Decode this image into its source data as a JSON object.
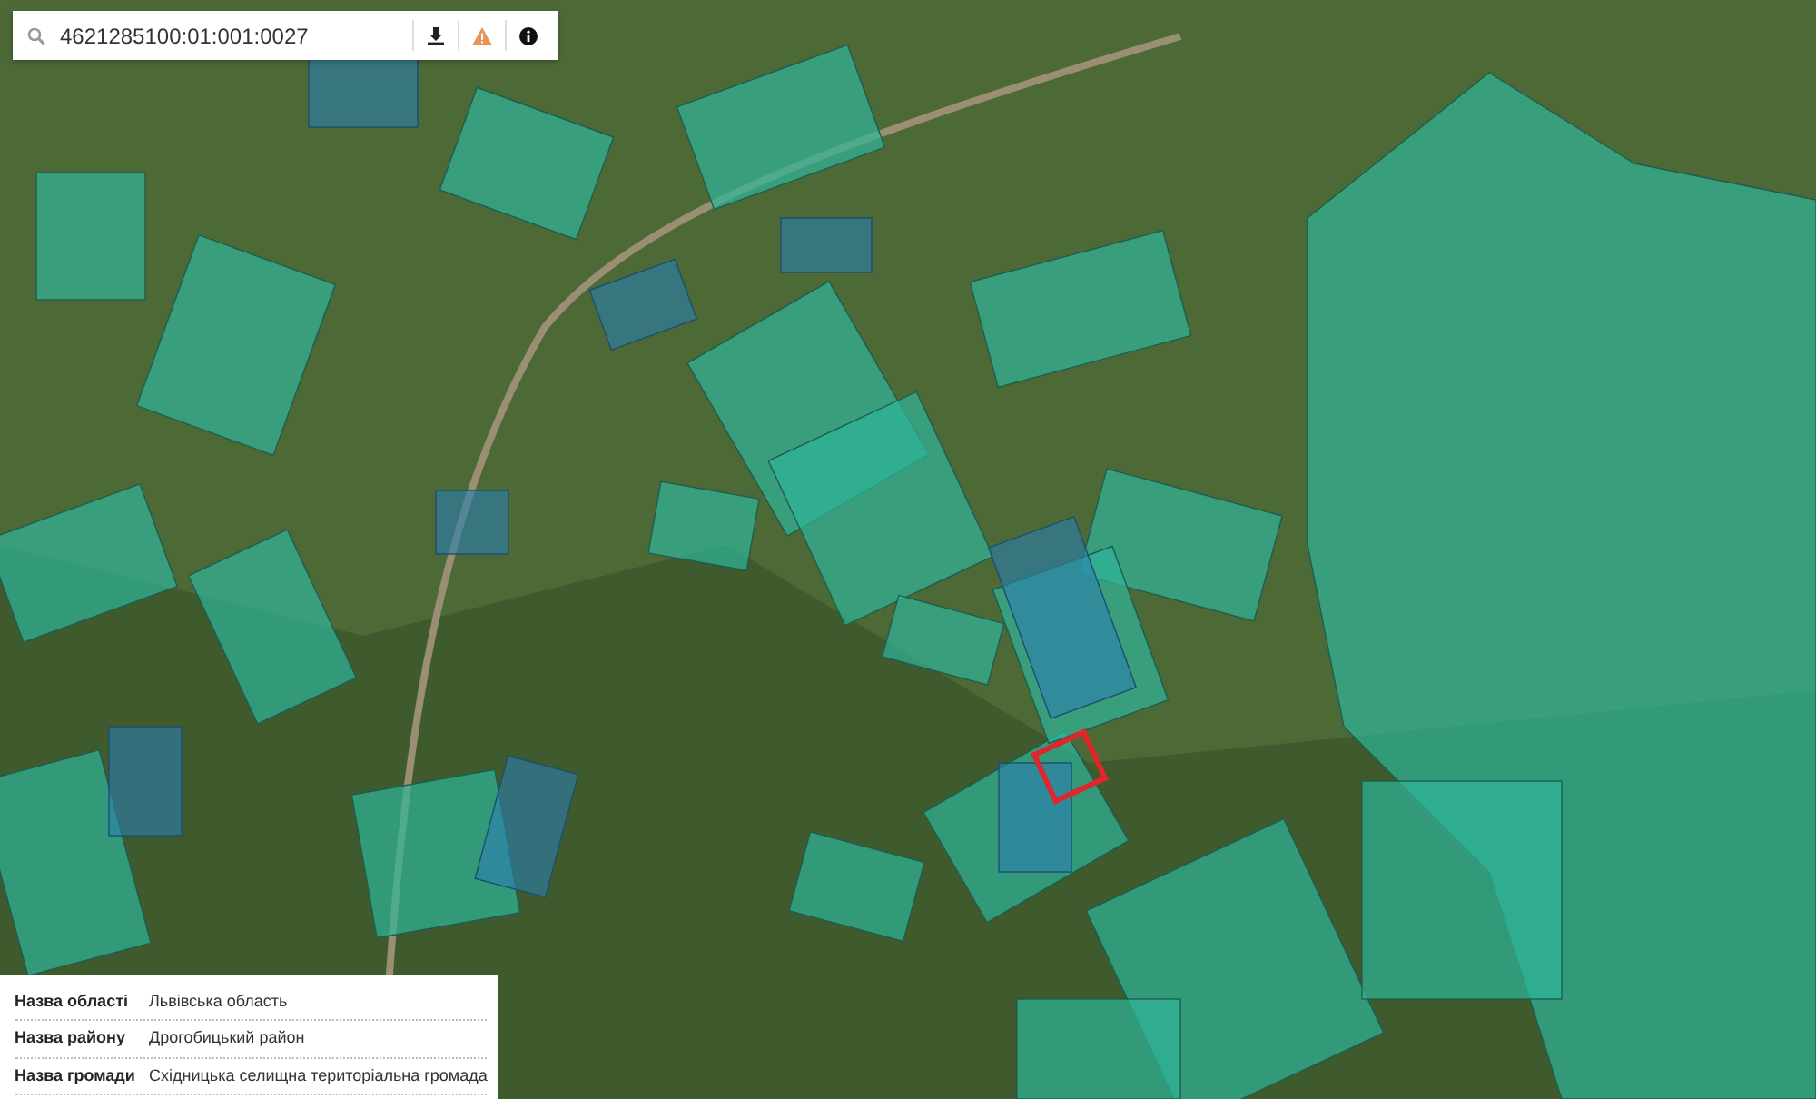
{
  "search": {
    "value": "4621285100:01:001:0027"
  },
  "info": [
    {
      "label": "Назва області",
      "value": "Львівська область"
    },
    {
      "label": "Назва району",
      "value": "Дрогобицький район"
    },
    {
      "label": "Назва громади",
      "value": "Східницька селищна територіальна громада"
    }
  ]
}
